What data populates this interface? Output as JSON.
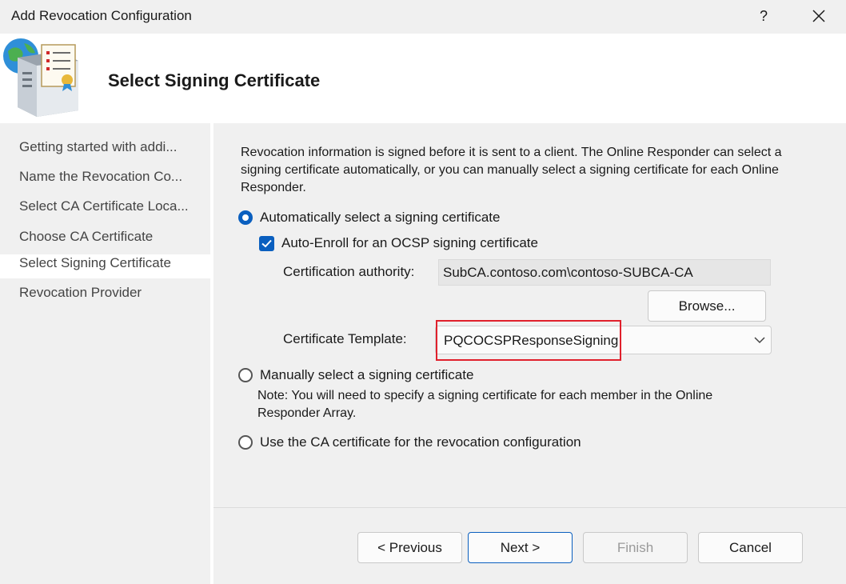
{
  "window": {
    "title": "Add Revocation Configuration",
    "help_label": "?",
    "close_icon": "close-icon"
  },
  "header": {
    "title": "Select Signing Certificate",
    "icon": "server-certificate-icon"
  },
  "sidebar": {
    "items": [
      {
        "label": "Getting started with addi..."
      },
      {
        "label": "Name the Revocation Co..."
      },
      {
        "label": "Select CA Certificate Loca..."
      },
      {
        "label": "Choose CA Certificate"
      },
      {
        "label": "Select Signing Certificate",
        "selected": true
      },
      {
        "label": "Revocation Provider"
      }
    ]
  },
  "main": {
    "description": "Revocation information is signed before it is sent to a client. The Online Responder can select a signing certificate automatically, or you can manually select a signing certificate for each Online Responder.",
    "option_auto": {
      "label": "Automatically select a signing certificate",
      "selected": true
    },
    "auto_enroll": {
      "label": "Auto-Enroll for an OCSP signing certificate",
      "checked": true
    },
    "ca_label": "Certification authority:",
    "ca_value": "SubCA.contoso.com\\contoso-SUBCA-CA",
    "browse_label": "Browse...",
    "template_label": "Certificate Template:",
    "template_value": "PQCOCSPResponseSigning",
    "option_manual": {
      "label": "Manually select a signing certificate",
      "selected": false
    },
    "note": "Note: You will need to specify a signing certificate for each member in the Online Responder Array.",
    "option_ca": {
      "label": "Use the CA certificate for the revocation configuration",
      "selected": false
    }
  },
  "footer": {
    "previous_label": "< Previous",
    "next_label": "Next >",
    "finish_label": "Finish",
    "cancel_label": "Cancel"
  },
  "colors": {
    "accent": "#0a5fbf",
    "highlight_border": "#e0202c"
  }
}
